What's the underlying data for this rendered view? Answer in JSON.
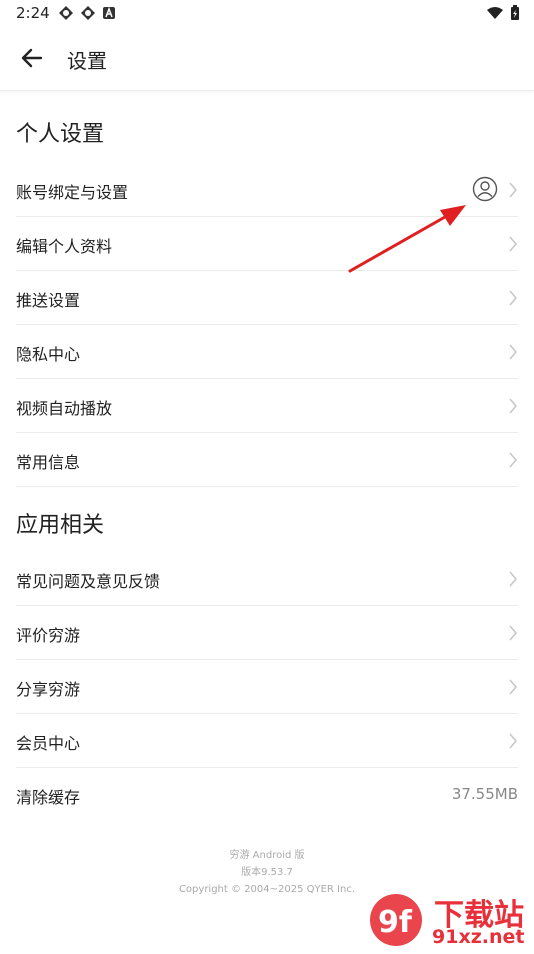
{
  "status_bar": {
    "time": "2:24",
    "left_icons": [
      "app-icon",
      "app-icon",
      "notification-a-icon"
    ],
    "right_icons": [
      "wifi-icon",
      "battery-icon"
    ]
  },
  "app_bar": {
    "title": "设置",
    "back_icon": "back-arrow-icon"
  },
  "sections": {
    "personal": {
      "title": "个人设置",
      "items": [
        {
          "label": "账号绑定与设置",
          "icon": "user-avatar-icon"
        },
        {
          "label": "编辑个人资料"
        },
        {
          "label": "推送设置"
        },
        {
          "label": "隐私中心"
        },
        {
          "label": "视频自动播放"
        },
        {
          "label": "常用信息"
        }
      ]
    },
    "app": {
      "title": "应用相关",
      "items": [
        {
          "label": "常见问题及意见反馈"
        },
        {
          "label": "评价穷游"
        },
        {
          "label": "分享穷游"
        },
        {
          "label": "会员中心"
        },
        {
          "label": "清除缓存",
          "value": "37.55MB"
        }
      ]
    }
  },
  "footer": {
    "line1": "穷游 Android 版",
    "line2": "版本9.53.7",
    "line3": "Copyright © 2004~2025 QYER Inc."
  },
  "watermark": {
    "text_top": "下载站",
    "text_bottom": "91xz.net",
    "logo": "9f"
  },
  "colors": {
    "annotation_arrow": "#e02020",
    "divider": "#ebebeb",
    "chevron": "#c8c8c8",
    "watermark_red": "#e8303a"
  }
}
